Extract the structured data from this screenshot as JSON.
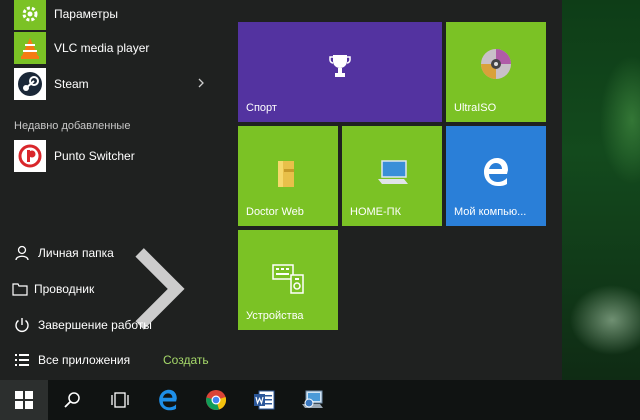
{
  "menu_items": {
    "settings": "Параметры",
    "vlc": "VLC media player",
    "steam": "Steam",
    "recently_added_header": "Недавно добавленные",
    "punto": "Punto Switcher"
  },
  "places": {
    "personal_folder": "Личная папка",
    "explorer": "Проводник",
    "shutdown": "Завершение работы",
    "all_apps": "Все приложения",
    "create": "Создать"
  },
  "tiles": {
    "sport": "Спорт",
    "ultraiso": "UltraISO",
    "drweb": "Doctor Web",
    "homepc": "HOME-ПК",
    "mycomputer": "Мой компью...",
    "devices": "Устройства"
  },
  "colors": {
    "accent_purple": "#5333a0",
    "accent_green": "#7bc225",
    "accent_blue": "#2a7fd8",
    "menu_bg": "#1f2120",
    "taskbar_bg": "#101312"
  },
  "taskbar": {
    "icons": [
      "windows-start-icon",
      "search-icon",
      "task-view-icon",
      "edge-icon",
      "chrome-icon",
      "word-icon",
      "network-icon"
    ]
  }
}
